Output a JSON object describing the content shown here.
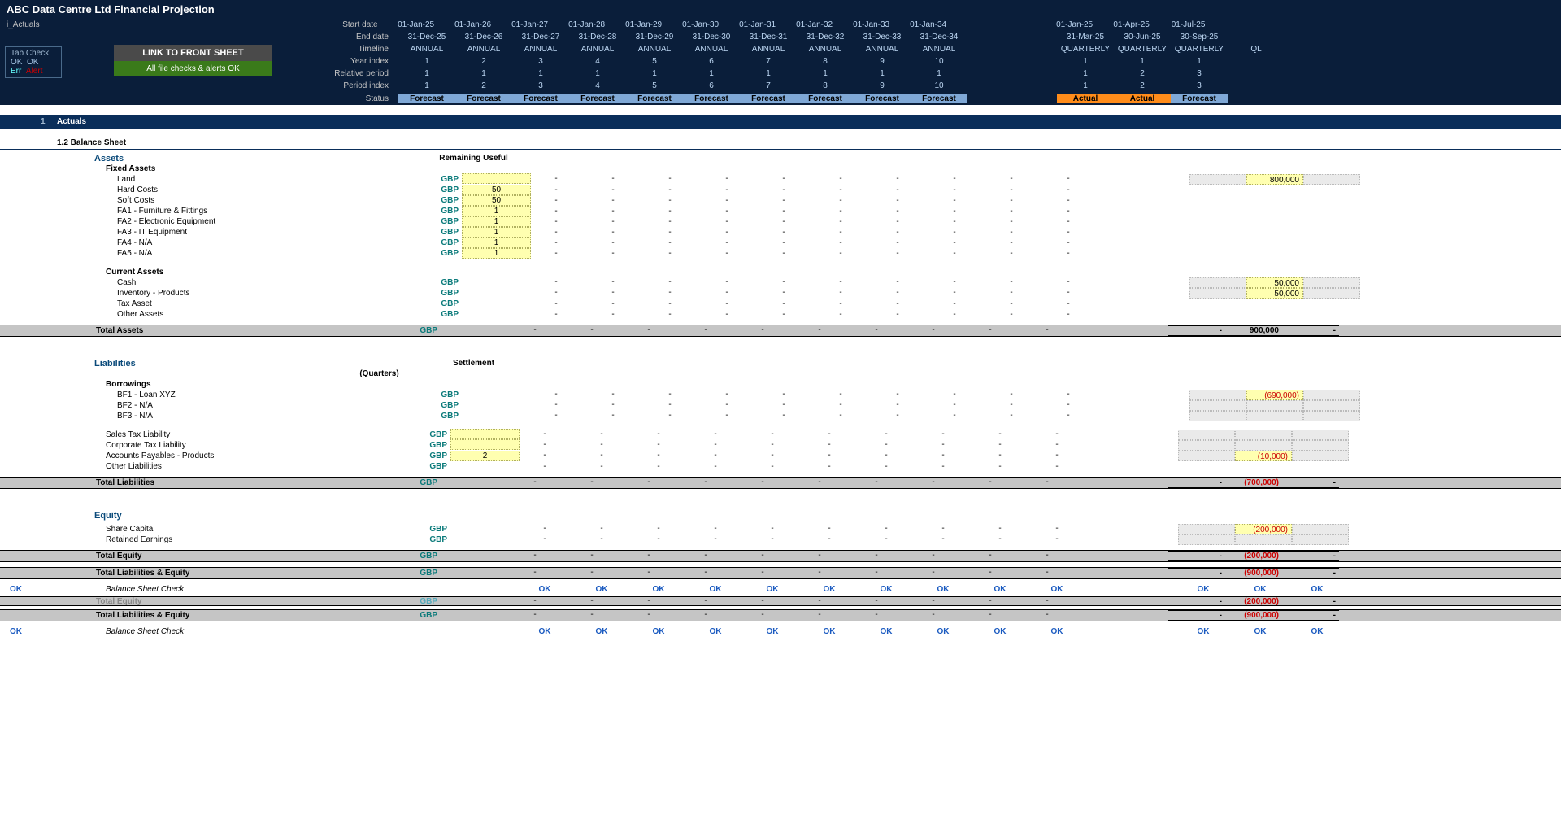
{
  "header": {
    "title": "ABC Data Centre Ltd Financial Projection",
    "subtitle": "i_Actuals",
    "labels": [
      "Start date",
      "End date",
      "Timeline",
      "Year index",
      "Relative period",
      "Period index",
      "Status"
    ],
    "annual_start": [
      "01-Jan-25",
      "01-Jan-26",
      "01-Jan-27",
      "01-Jan-28",
      "01-Jan-29",
      "01-Jan-30",
      "01-Jan-31",
      "01-Jan-32",
      "01-Jan-33",
      "01-Jan-34"
    ],
    "annual_end": [
      "31-Dec-25",
      "31-Dec-26",
      "31-Dec-27",
      "31-Dec-28",
      "31-Dec-29",
      "31-Dec-30",
      "31-Dec-31",
      "31-Dec-32",
      "31-Dec-33",
      "31-Dec-34"
    ],
    "annual_timeline": [
      "ANNUAL",
      "ANNUAL",
      "ANNUAL",
      "ANNUAL",
      "ANNUAL",
      "ANNUAL",
      "ANNUAL",
      "ANNUAL",
      "ANNUAL",
      "ANNUAL"
    ],
    "year_index": [
      "1",
      "2",
      "3",
      "4",
      "5",
      "6",
      "7",
      "8",
      "9",
      "10"
    ],
    "rel_period": [
      "1",
      "1",
      "1",
      "1",
      "1",
      "1",
      "1",
      "1",
      "1",
      "1"
    ],
    "period_index": [
      "1",
      "2",
      "3",
      "4",
      "5",
      "6",
      "7",
      "8",
      "9",
      "10"
    ],
    "status": [
      "Forecast",
      "Forecast",
      "Forecast",
      "Forecast",
      "Forecast",
      "Forecast",
      "Forecast",
      "Forecast",
      "Forecast",
      "Forecast"
    ],
    "q_start": [
      "01-Jan-25",
      "01-Apr-25",
      "01-Jul-25"
    ],
    "q_end": [
      "31-Mar-25",
      "30-Jun-25",
      "30-Sep-25"
    ],
    "q_timeline": [
      "QUARTERLY",
      "QUARTERLY",
      "QUARTERLY"
    ],
    "q_extra": "QL",
    "q_year_index": [
      "1",
      "1",
      "1"
    ],
    "q_rel_period": [
      "1",
      "2",
      "3"
    ],
    "q_period_index": [
      "1",
      "2",
      "3"
    ],
    "q_status": [
      "Actual",
      "Actual",
      "Forecast"
    ]
  },
  "tabcheck": {
    "label": "Tab Check",
    "r1a": "OK",
    "r1b": "OK",
    "r2a": "Err",
    "r2b": "Alert"
  },
  "buttons": {
    "link": "LINK TO FRONT SHEET",
    "ok": "All file checks & alerts OK"
  },
  "section": {
    "num": "1",
    "name": "Actuals",
    "sub": "1.2   Balance Sheet"
  },
  "hdr2": {
    "left": "Remaining Useful",
    "right": "Settlement",
    "right2": "(Quarters)"
  },
  "assets": {
    "title": "Assets",
    "fixed": "Fixed Assets",
    "rows": [
      {
        "n": "Land",
        "c": "GBP",
        "inp": "",
        "inpshow": true,
        "q2": "800,000",
        "blank": true
      },
      {
        "n": "Hard Costs",
        "c": "GBP",
        "inp": "50",
        "inpshow": true
      },
      {
        "n": "Soft Costs",
        "c": "GBP",
        "inp": "50",
        "inpshow": true
      },
      {
        "n": "FA1 - Furniture & Fittings",
        "c": "GBP",
        "inp": "1",
        "inpshow": true
      },
      {
        "n": "FA2 - Electronic Equipment",
        "c": "GBP",
        "inp": "1",
        "inpshow": true
      },
      {
        "n": "FA3 - IT Equipment",
        "c": "GBP",
        "inp": "1",
        "inpshow": true
      },
      {
        "n": "FA4 - N/A",
        "c": "GBP",
        "inp": "1",
        "inpshow": true
      },
      {
        "n": "FA5 - N/A",
        "c": "GBP",
        "inp": "1",
        "inpshow": true
      }
    ],
    "current": "Current Assets",
    "crows": [
      {
        "n": "Cash",
        "c": "GBP",
        "q2": "50,000"
      },
      {
        "n": "Inventory - Products",
        "c": "GBP",
        "q2": "50,000"
      },
      {
        "n": "Tax Asset",
        "c": "GBP"
      },
      {
        "n": "Other Assets",
        "c": "GBP"
      }
    ],
    "total": {
      "n": "Total Assets",
      "c": "GBP",
      "q2": "900,000"
    }
  },
  "liab": {
    "title": "Liabilities",
    "borrow": "Borrowings",
    "rows": [
      {
        "n": "BF1 - Loan XYZ",
        "c": "GBP",
        "q2": "(690,000)",
        "neg": true
      },
      {
        "n": "BF2 - N/A",
        "c": "GBP",
        "blank": true
      },
      {
        "n": "BF3 - N/A",
        "c": "GBP",
        "blank": true
      }
    ],
    "rows2": [
      {
        "n": "Sales Tax Liability",
        "c": "GBP",
        "inpshow": true,
        "blank": true
      },
      {
        "n": "Corporate Tax Liability",
        "c": "GBP",
        "inpshow": true,
        "blank": true
      },
      {
        "n": "Accounts Payables - Products",
        "c": "GBP",
        "inp": "2",
        "inpshow": true,
        "q2": "(10,000)",
        "neg": true
      },
      {
        "n": "Other Liabilities",
        "c": "GBP"
      }
    ],
    "total": {
      "n": "Total Liabilities",
      "c": "GBP",
      "q2": "(700,000)",
      "neg": true
    }
  },
  "equity": {
    "title": "Equity",
    "rows": [
      {
        "n": "Share Capital",
        "c": "GBP",
        "q2": "(200,000)",
        "neg": true
      },
      {
        "n": "Retained Earnings",
        "c": "GBP",
        "blank": true
      }
    ],
    "total": {
      "n": "Total Equity",
      "c": "GBP",
      "q2": "(200,000)",
      "neg": true
    },
    "tle": {
      "n": "Total Liabilities & Equity",
      "c": "GBP",
      "q2": "(900,000)",
      "neg": true
    }
  },
  "check": {
    "label": "Balance Sheet Check",
    "ok": "OK"
  },
  "dup": {
    "tle": {
      "n": "Total Liabilities & Equity",
      "c": "GBP",
      "q2": "(900,000)",
      "neg": true
    }
  }
}
